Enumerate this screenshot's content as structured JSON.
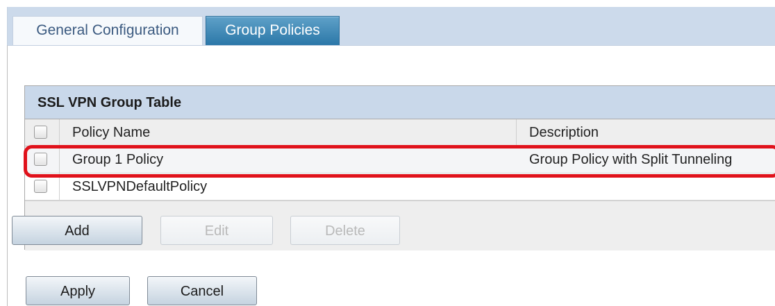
{
  "tabs": [
    {
      "label": "General Configuration",
      "active": false
    },
    {
      "label": "Group Policies",
      "active": true
    }
  ],
  "table": {
    "title": "SSL VPN Group Table",
    "columns": [
      "Policy Name",
      "Description"
    ],
    "rows": [
      {
        "name": "Group 1 Policy",
        "description": "Group Policy with Split Tunneling",
        "highlighted": true
      },
      {
        "name": "SSLVPNDefaultPolicy",
        "description": ""
      }
    ]
  },
  "table_buttons": {
    "add": "Add",
    "edit": "Edit",
    "delete": "Delete"
  },
  "form_buttons": {
    "apply": "Apply",
    "cancel": "Cancel"
  },
  "colors": {
    "active_tab": "#2b77a8",
    "table_header": "#c9d8ea",
    "highlight": "#e0121b"
  }
}
